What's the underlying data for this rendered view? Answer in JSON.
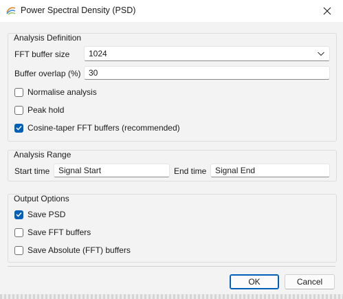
{
  "window": {
    "title": "Power Spectral Density (PSD)"
  },
  "analysis_definition": {
    "title": "Analysis Definition",
    "fft_buffer_size": {
      "label": "FFT buffer size",
      "value": "1024"
    },
    "buffer_overlap": {
      "label": "Buffer overlap (%)",
      "value": "30"
    },
    "normalise": {
      "label": "Normalise analysis",
      "checked": false
    },
    "peak_hold": {
      "label": "Peak hold",
      "checked": false
    },
    "cosine_taper": {
      "label": "Cosine-taper FFT buffers (recommended)",
      "checked": true
    }
  },
  "analysis_range": {
    "title": "Analysis Range",
    "start_time": {
      "label": "Start time",
      "value": "Signal Start"
    },
    "end_time": {
      "label": "End time",
      "value": "Signal End"
    }
  },
  "output_options": {
    "title": "Output Options",
    "save_psd": {
      "label": "Save PSD",
      "checked": true
    },
    "save_fft": {
      "label": "Save FFT buffers",
      "checked": false
    },
    "save_abs_fft": {
      "label": "Save Absolute (FFT) buffers",
      "checked": false
    }
  },
  "buttons": {
    "ok": "OK",
    "cancel": "Cancel"
  },
  "colors": {
    "accent": "#005fb8",
    "background": "#f3f3f3"
  }
}
